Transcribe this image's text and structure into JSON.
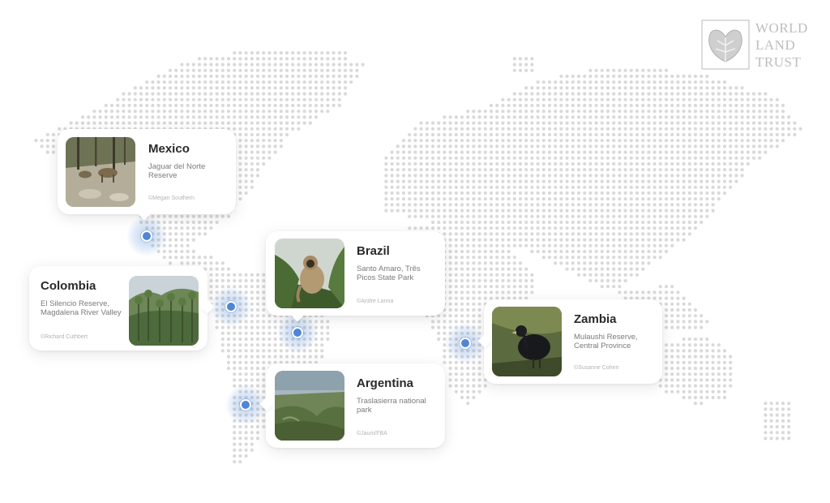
{
  "brand": {
    "line1": "WORLD",
    "line2": "LAND",
    "line3": "TRUST",
    "icon": "leaf-icon",
    "color": "#bdbdbd"
  },
  "colors": {
    "pin": "#4f86d6",
    "map_dot": "#d9d9d9",
    "title": "#2a2a2a",
    "desc": "#7a7a7a"
  },
  "locations": [
    {
      "country": "Mexico",
      "reserve": "Jaguar del Norte Reserve",
      "credit": "©Megan Southern",
      "image": "deer-photo"
    },
    {
      "country": "Colombia",
      "reserve": "El Silencio Reserve, Magdalena River Valley",
      "credit": "©Richard Cuthbert",
      "image": "palm-forest-photo"
    },
    {
      "country": "Brazil",
      "reserve": "Santo Amaro, Três Picos State Park",
      "credit": "©Andre Lanna",
      "image": "monkey-photo"
    },
    {
      "country": "Argentina",
      "reserve": "Traslasierra national park",
      "credit": "©Jaum/FBA",
      "image": "mountain-valley-photo"
    },
    {
      "country": "Zambia",
      "reserve": "Mulaushi Reserve, Central Province",
      "credit": "©Susanne Cohen",
      "image": "bird-photo"
    }
  ]
}
